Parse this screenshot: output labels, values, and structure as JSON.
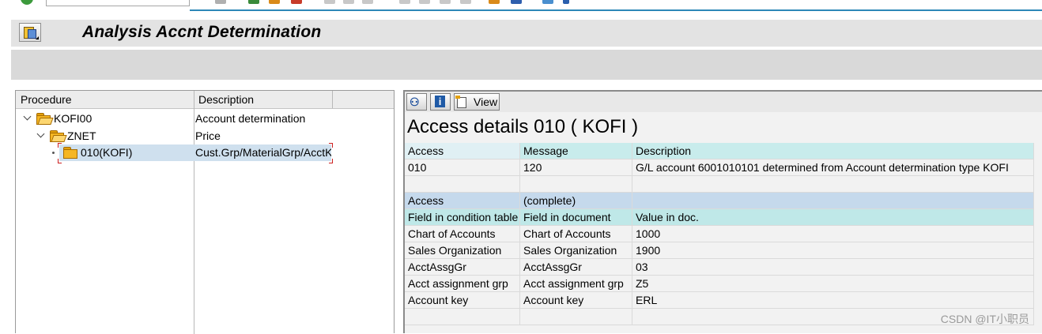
{
  "page": {
    "title": "Analysis Accnt Determination"
  },
  "tree": {
    "columns": [
      "Procedure",
      "Description"
    ],
    "rows": [
      {
        "procedure": "KOFI00",
        "description": "Account determination"
      },
      {
        "procedure": "ZNET",
        "description": "Price"
      },
      {
        "procedure": "010(KOFI)",
        "description": "Cust.Grp/MaterialGrp/AcctKey"
      }
    ]
  },
  "detail": {
    "toolbar": {
      "view_label": "View"
    },
    "heading": "Access details 010 ( KOFI )",
    "access_columns": [
      "Access",
      "Message",
      "Description"
    ],
    "access_row": [
      "010",
      "120",
      "G/L account 6001010101 determined from Account determination type KOFI"
    ],
    "access_header2": [
      "Access",
      "(complete)",
      ""
    ],
    "field_columns": [
      "Field in condition table",
      "Field in document",
      "Value in doc."
    ],
    "field_rows": [
      [
        "Chart of Accounts",
        "Chart of Accounts",
        "1000"
      ],
      [
        "Sales Organization",
        "Sales Organization",
        "1900"
      ],
      [
        "AcctAssgGr",
        "AcctAssgGr",
        "03"
      ],
      [
        "Acct assignment grp",
        "Acct assignment grp",
        "Z5"
      ],
      [
        "Account key",
        "Account key",
        "ERL"
      ]
    ]
  },
  "watermark": "CSDN @IT小职员"
}
